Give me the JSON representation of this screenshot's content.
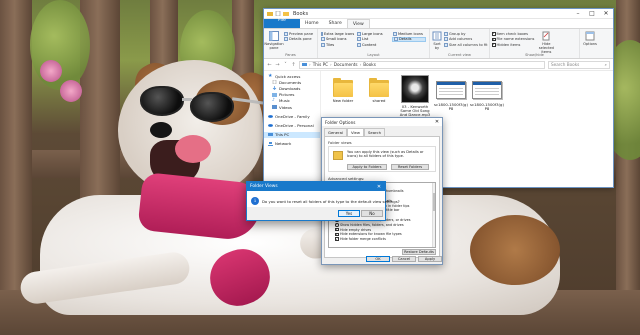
{
  "explorer": {
    "title": "Books",
    "tabs": [
      "File",
      "Home",
      "Share",
      "View"
    ],
    "active_tab": "View",
    "ribbon": {
      "panes": {
        "navigation_pane": "Navigation pane",
        "preview_pane": "Preview pane",
        "details_pane": "Details pane",
        "group_label": "Panes"
      },
      "layout": {
        "items": [
          "Extra large icons",
          "Large icons",
          "Medium icons",
          "Small icons",
          "List",
          "Details",
          "Tiles",
          "Content"
        ],
        "selected": "Details",
        "group_label": "Layout"
      },
      "current_view": {
        "group_by": "Group by",
        "add_columns": "Add columns",
        "size_all_columns": "Size all columns to fit",
        "sort_by": "Sort by",
        "group_label": "Current view"
      },
      "show_hide": {
        "item_check_boxes": "Item check boxes",
        "file_name_extensions": "File name extensions",
        "hidden_items": "Hidden items",
        "hide_selected_items": "Hide selected items",
        "group_label": "Show/hide"
      },
      "options": {
        "label": "Options"
      }
    },
    "address": {
      "crumbs": [
        "This PC",
        "Documents",
        "Books"
      ],
      "search_placeholder": "Search Books"
    },
    "nav_pane": {
      "items": [
        {
          "label": "Quick access",
          "indent": false,
          "icon": "star-icon"
        },
        {
          "label": "Documents",
          "indent": true,
          "icon": "documents-icon"
        },
        {
          "label": "Downloads",
          "indent": true,
          "icon": "download-icon"
        },
        {
          "label": "Pictures",
          "indent": true,
          "icon": "pictures-icon"
        },
        {
          "label": "Music",
          "indent": true,
          "icon": "music-icon"
        },
        {
          "label": "Videos",
          "indent": true,
          "icon": "video-icon"
        },
        {
          "label": "OneDrive - Family",
          "indent": false,
          "icon": "cloud-icon"
        },
        {
          "label": "OneDrive - Personal",
          "indent": false,
          "icon": "cloud-icon"
        },
        {
          "label": "This PC",
          "indent": false,
          "icon": "computer-icon"
        },
        {
          "label": "Network",
          "indent": false,
          "icon": "network-icon"
        }
      ],
      "selected": "This PC"
    },
    "files": [
      {
        "name": "New folder",
        "kind": "folder"
      },
      {
        "name": "shared",
        "kind": "folder"
      },
      {
        "name": "03 - Kenworth Some Old Song And Dance.mp3",
        "kind": "image"
      },
      {
        "name": "sc1800-1500f3(g) P8",
        "kind": "document"
      },
      {
        "name": "sc1800-1500f3(g) P8",
        "kind": "document"
      }
    ]
  },
  "folder_options": {
    "title": "Folder Options",
    "tabs": [
      "General",
      "View",
      "Search"
    ],
    "active_tab": "View",
    "folder_views_label": "Folder views",
    "folder_views_text": "You can apply this view (such as Details or Icons) to all folders of this type.",
    "apply_to_folders": "Apply to Folders",
    "reset_folders": "Reset Folders",
    "advanced_label": "Advanced settings:",
    "advanced_rows": [
      {
        "label": "Files and Folders",
        "indent": false,
        "checked": null,
        "selected": false
      },
      {
        "label": "Always show icons, never thumbnails",
        "indent": true,
        "checked": false,
        "selected": false
      },
      {
        "label": "Always show menus",
        "indent": true,
        "checked": false,
        "selected": false
      },
      {
        "label": "Display file icon on thumbnails",
        "indent": true,
        "checked": true,
        "selected": false
      },
      {
        "label": "Display file size information in folder tips",
        "indent": true,
        "checked": true,
        "selected": false
      },
      {
        "label": "Display the full path in the title bar",
        "indent": true,
        "checked": false,
        "selected": false
      },
      {
        "label": "Hidden files and folders",
        "indent": true,
        "checked": null,
        "selected": false
      },
      {
        "label": "Don't show hidden files, folders, or drives",
        "indent": true,
        "checked": false,
        "selected": false
      },
      {
        "label": "Show hidden files, folders, and drives",
        "indent": true,
        "checked": true,
        "selected": false
      },
      {
        "label": "Hide empty drives",
        "indent": true,
        "checked": true,
        "selected": false
      },
      {
        "label": "Hide extensions for known file types",
        "indent": true,
        "checked": true,
        "selected": false
      },
      {
        "label": "Hide folder merge conflicts",
        "indent": true,
        "checked": true,
        "selected": false
      }
    ],
    "restore_defaults": "Restore Defaults",
    "ok": "OK",
    "cancel": "Cancel",
    "apply": "Apply"
  },
  "folder_view": {
    "title": "Folder Views",
    "question": "Do you want to reset all folders of this type to the default view settings?",
    "yes": "Yes",
    "no": "No"
  },
  "colors": {
    "accent": "#1979ca",
    "selection": "#cce8ff",
    "folder": "#f4c246"
  }
}
